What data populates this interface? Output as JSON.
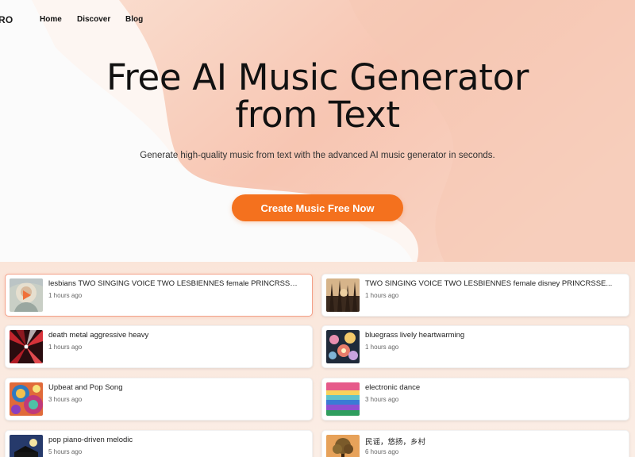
{
  "nav": {
    "brand": "RO",
    "links": [
      "Home",
      "Discover",
      "Blog"
    ]
  },
  "hero": {
    "title_line1": "Free AI Music Generator",
    "title_line2": "from Text",
    "subtitle": "Generate high-quality music from text with the advanced AI music generator in seconds.",
    "cta_label": "Create Music Free Now"
  },
  "colors": {
    "accent": "#f4711e",
    "active_border": "#f3a088",
    "background_blob": "#f8c7b6"
  },
  "songs": [
    {
      "title": "lesbians TWO SINGING VOICE TWO LESBIENNES female PRINCRSSE...",
      "time": "1 hours ago",
      "thumb_icon": "dreamy-portrait-art"
    },
    {
      "title": "TWO SINGING VOICE TWO LESBIENNES female disney PRINCRSSE...",
      "time": "1 hours ago",
      "thumb_icon": "forest-silhouette-art"
    },
    {
      "title": "death metal aggressive heavy",
      "time": "1 hours ago",
      "thumb_icon": "red-tunnel-art"
    },
    {
      "title": "bluegrass lively heartwarming",
      "time": "1 hours ago",
      "thumb_icon": "floral-night-art"
    },
    {
      "title": "Upbeat and Pop Song",
      "time": "3 hours ago",
      "thumb_icon": "psychedelic-swirl-art"
    },
    {
      "title": "electronic dance",
      "time": "3 hours ago",
      "thumb_icon": "neon-landscape-art"
    },
    {
      "title": "pop piano-driven melodic",
      "time": "5 hours ago",
      "thumb_icon": "piano-night-art"
    },
    {
      "title": "民谣，悠扬，乡村",
      "time": "6 hours ago",
      "thumb_icon": "tree-sunset-art"
    }
  ]
}
